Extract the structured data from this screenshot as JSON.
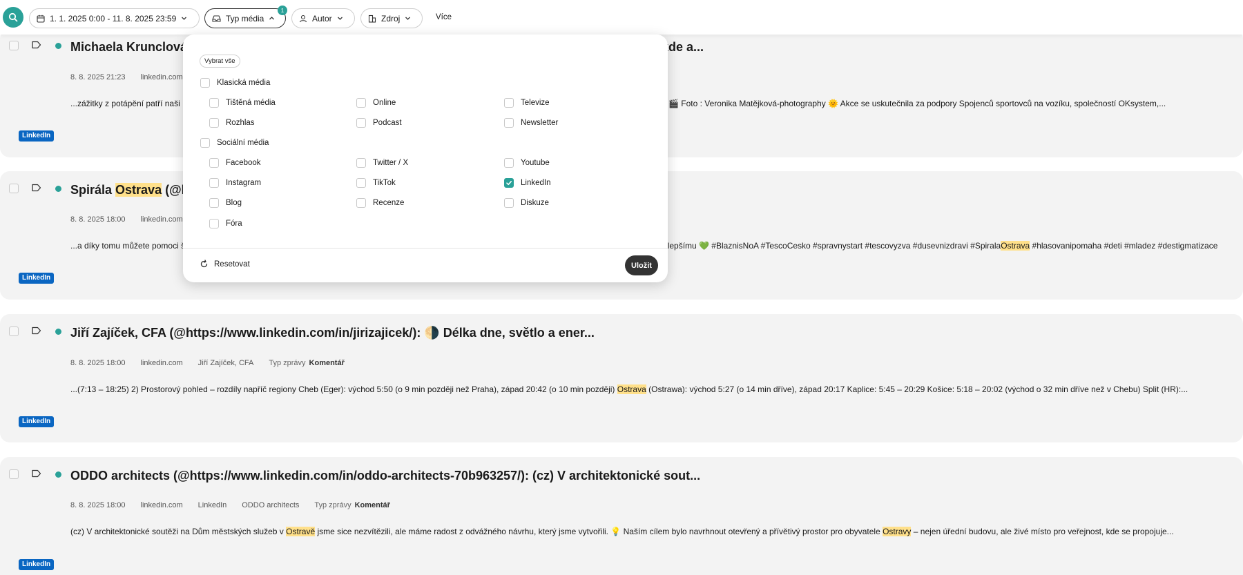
{
  "filters": {
    "date_range": "1. 1. 2025 0:00 - 11. 8. 2025 23:59",
    "media_type_label": "Typ média",
    "media_type_count": "1",
    "author_label": "Autor",
    "source_label": "Zdroj",
    "more_label": "Více"
  },
  "dropdown": {
    "select_all": "Vybrat vše",
    "groups": [
      {
        "label": "Klasická média",
        "items": [
          "Tištěná média",
          "Online",
          "Televize",
          "Rozhlas",
          "Podcast",
          "Newsletter"
        ]
      },
      {
        "label": "Sociální média",
        "items": [
          "Facebook",
          "Twitter / X",
          "Youtube",
          "Instagram",
          "TikTok",
          "LinkedIn",
          "Blog",
          "Recenze",
          "Diskuze",
          "Fóra"
        ]
      }
    ],
    "checked": "LinkedIn",
    "reset": "Resetovat",
    "save": "Uložit"
  },
  "articles": [
    {
      "title_pre": "Michaela Krunclová",
      "title_mid": "",
      "title_post": "",
      "title_tail": "kde a...",
      "date": "8. 8. 2025 21:23",
      "domain": "linkedin.com",
      "snippet_pre": "...zážitky z potápění patří naši",
      "snippet_hl": "",
      "snippet_post": "",
      "snippet_tail": "🎬 Foto : Veronika Matějková-photography 🌞 Akce se uskutečnila za podpory Spojenců sportovců na vozíku, společností OKsystem,...",
      "source": "LinkedIn"
    },
    {
      "title_pre": "Spirála ",
      "title_mid": "Ostrava",
      "title_post": " (@h",
      "title_tail": "",
      "date": "8. 8. 2025 18:00",
      "domain": "linkedin.com",
      "snippet_pre": "...a díky tomu můžete pomoci š",
      "snippet_tail_pre": "ět k lepšímu 💚 #BlaznisNoA #TescoCesko #spravnystart #tescovyzva #dusevnizdravi #Spirala",
      "snippet_tail_hl": "Ostrava",
      "snippet_tail_post": " #hlasovanipomaha #deti #mladez #destigmatizace",
      "source": "LinkedIn"
    },
    {
      "title": "Jiří Zajíček, CFA (@https://www.linkedin.com/in/jirizajicek/): 🌗 Délka dne, světlo a ener...",
      "date": "8. 8. 2025 18:00",
      "domain": "linkedin.com",
      "author": "Jiří Zajíček, CFA",
      "type_label": "Typ zprávy",
      "type_value": "Komentář",
      "snippet_pre": "...(7:13 – 18:25) 2) Prostorový pohled – rozdíly napříč regiony Cheb (Eger): východ 5:50 (o 9 min později než Praha), západ 20:42 (o 10 min později) ",
      "snippet_hl": "Ostrava",
      "snippet_post": " (Ostrawa): východ 5:27 (o 14 min dříve), západ 20:17 Kaplice: 5:45 – 20:29 Košice: 5:18 – 20:02 (východ o 32 min dříve než v Chebu) Split (HR):...",
      "source": "LinkedIn"
    },
    {
      "title": "ODDO architects (@https://www.linkedin.com/in/oddo-architects-70b963257/): (cz) V architektonické sout...",
      "date": "8. 8. 2025 18:00",
      "domain": "linkedin.com",
      "network": "LinkedIn",
      "author": "ODDO architects",
      "type_label": "Typ zprávy",
      "type_value": "Komentář",
      "snippet_pre": "(cz) V architektonické soutěži na Dům městských služeb v ",
      "snippet_hl": "Ostravě",
      "snippet_mid": " jsme sice nezvítězili, ale máme radost z odvážného návrhu, který jsme vytvořili. 💡 Naším cílem bylo navrhnout otevřený a přívětivý prostor pro obyvatele ",
      "snippet_hl2": "Ostravy",
      "snippet_post": " – nejen úřední budovu, ale živé místo pro veřejnost, kde se propojuje...",
      "source": "LinkedIn"
    }
  ],
  "colors": {
    "accent": "#2aa198",
    "linkedin": "#0a66c2",
    "highlight": "#ffe08a",
    "card_bg": "#f3f3f3"
  }
}
